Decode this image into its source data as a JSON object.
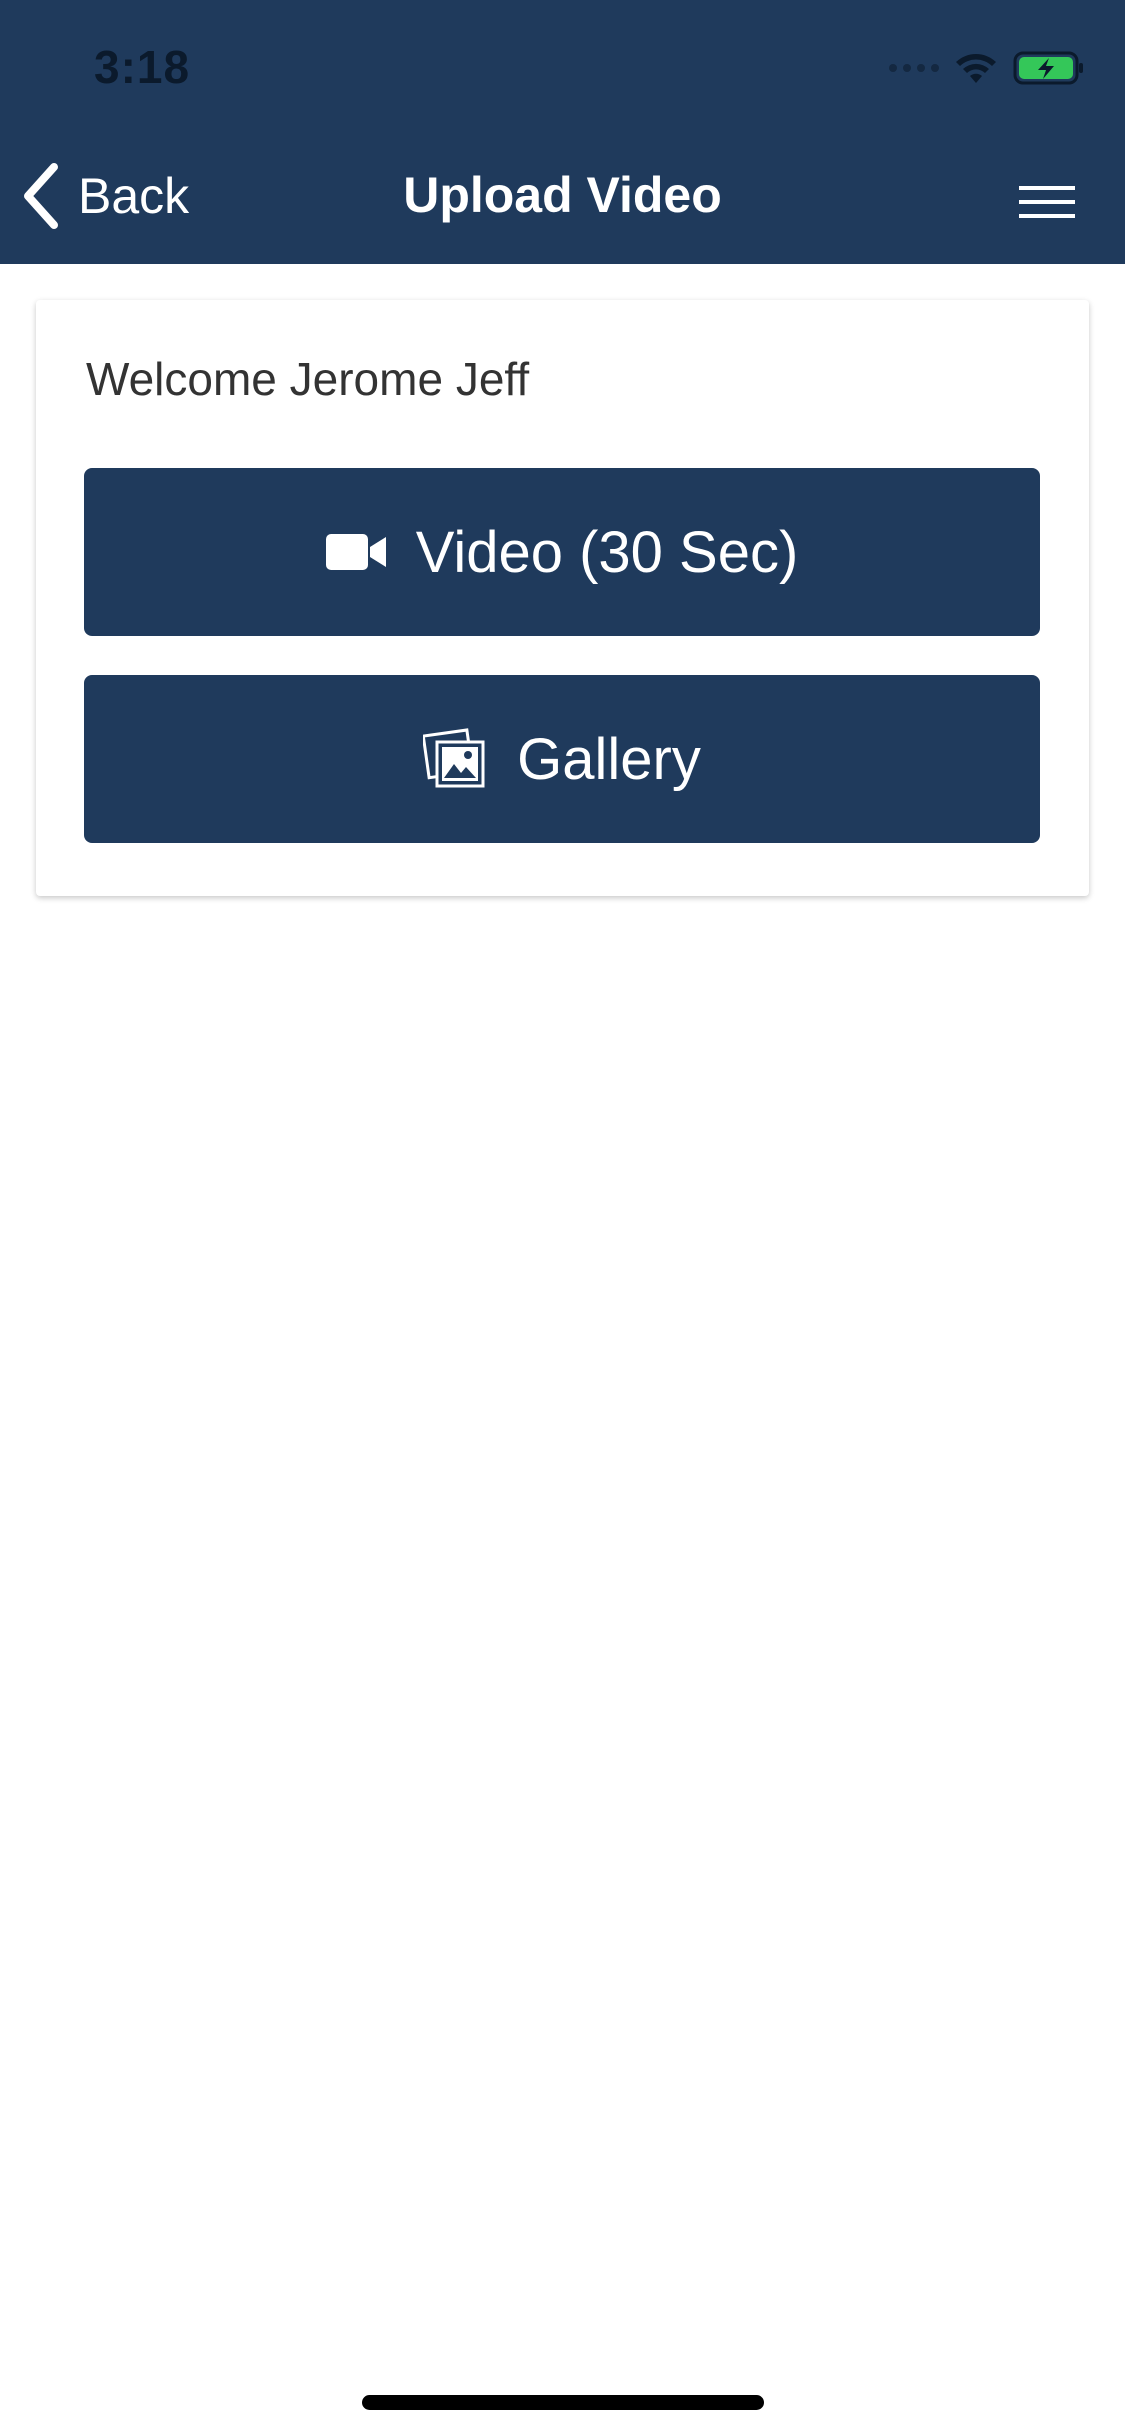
{
  "status_bar": {
    "time": "3:18",
    "battery_color": "#34c759"
  },
  "nav": {
    "back_label": "Back",
    "title": "Upload Video"
  },
  "card": {
    "welcome_text": "Welcome Jerome Jeff",
    "video_button_label": "Video (30 Sec)",
    "gallery_button_label": "Gallery"
  },
  "icons": {
    "back": "chevron-left-icon",
    "menu": "hamburger-menu-icon",
    "video": "video-camera-icon",
    "gallery": "photo-gallery-icon",
    "wifi": "wifi-icon",
    "battery": "battery-charging-icon"
  },
  "colors": {
    "primary": "#1f3a5c",
    "background": "#ffffff",
    "welcome_text": "#333333"
  }
}
